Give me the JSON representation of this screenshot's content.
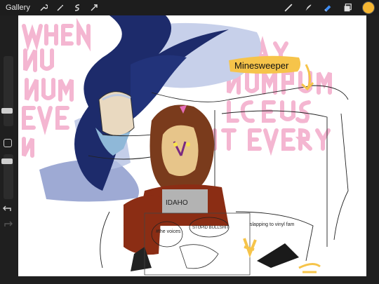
{
  "toolbar": {
    "gallery_label": "Gallery",
    "left_icons": [
      "wrench-icon",
      "magic-wand-icon",
      "selection-icon",
      "transform-icon"
    ],
    "right_icons": [
      "brush-icon",
      "smudge-icon",
      "eraser-icon",
      "layers-icon",
      "color-icon"
    ],
    "active_tool": "eraser",
    "active_color": "#f5b632"
  },
  "sidebar": {
    "brush_size_level": 0.52,
    "opacity_level": 0.15,
    "icons": [
      "modify-icon",
      "undo-icon",
      "redo-icon"
    ]
  },
  "canvas": {
    "annotation_label": "Minesweeper",
    "shirt_text": "IDAHO",
    "bubble_left": "#the voices",
    "bubble_middle": "STUPID BULLSHIT",
    "caption_right": "slapping to vinyl fam",
    "bg_lettering": "WHEN NUMBERS NUMBERS EVERY GRAY NUMBER LOSE US IT EVERY DAY",
    "colors": {
      "pink_lettering": "#f4b3cf",
      "navy_hair": "#1d2b6b",
      "lavender": "#8d9bcd",
      "brown_hair": "#7a3b1c",
      "jacket": "#8b2d14",
      "skin": "#e7c58a",
      "highlight_yellow": "#f6c44a"
    }
  }
}
